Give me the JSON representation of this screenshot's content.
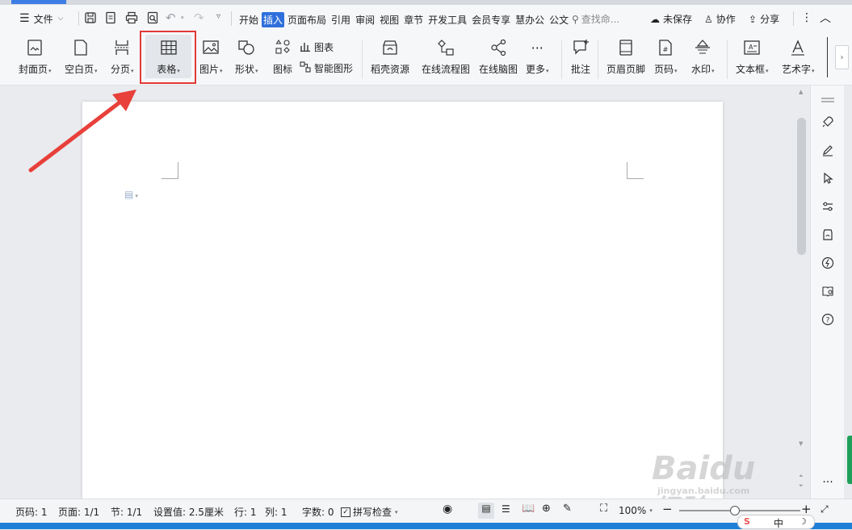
{
  "menu": {
    "file_label": "文件",
    "tabs": [
      "开始",
      "插入",
      "页面布局",
      "引用",
      "审阅",
      "视图",
      "章节",
      "开发工具",
      "会员专享",
      "慧办公",
      "公文"
    ],
    "active_tab": "插入",
    "search_placeholder": "查找命...",
    "unsaved_label": "未保存",
    "collab_label": "协作",
    "share_label": "分享"
  },
  "ribbon": {
    "cover": "封面页",
    "blank": "空白页",
    "pagebreak": "分页",
    "table": "表格",
    "picture": "图片",
    "shape": "形状",
    "icon": "图标",
    "chart": "图表",
    "smartart": "智能图形",
    "resource": "稻壳资源",
    "flowchart": "在线流程图",
    "mindmap": "在线脑图",
    "more": "更多",
    "comment": "批注",
    "headerfooter": "页眉页脚",
    "pagenum": "页码",
    "watermark": "水印",
    "textbox": "文本框",
    "wordart": "艺术字"
  },
  "status": {
    "page_num": "页码: 1",
    "page_count": "页面: 1/1",
    "section": "节: 1/1",
    "setting": "设置值: 2.5厘米",
    "row": "行: 1",
    "col": "列: 1",
    "word_count": "字数: 0",
    "spellcheck": "拼写检查",
    "zoom": "100%",
    "zoom_level": 1.0
  },
  "tray": {
    "ime": "中"
  },
  "watermark": {
    "brand": "Baidu",
    "brand_cn": "经验",
    "url": "jingyan.baidu.com"
  },
  "colors": {
    "accent": "#2f6fdc",
    "highlight": "#e23a36",
    "arrow": "#e8403a"
  }
}
